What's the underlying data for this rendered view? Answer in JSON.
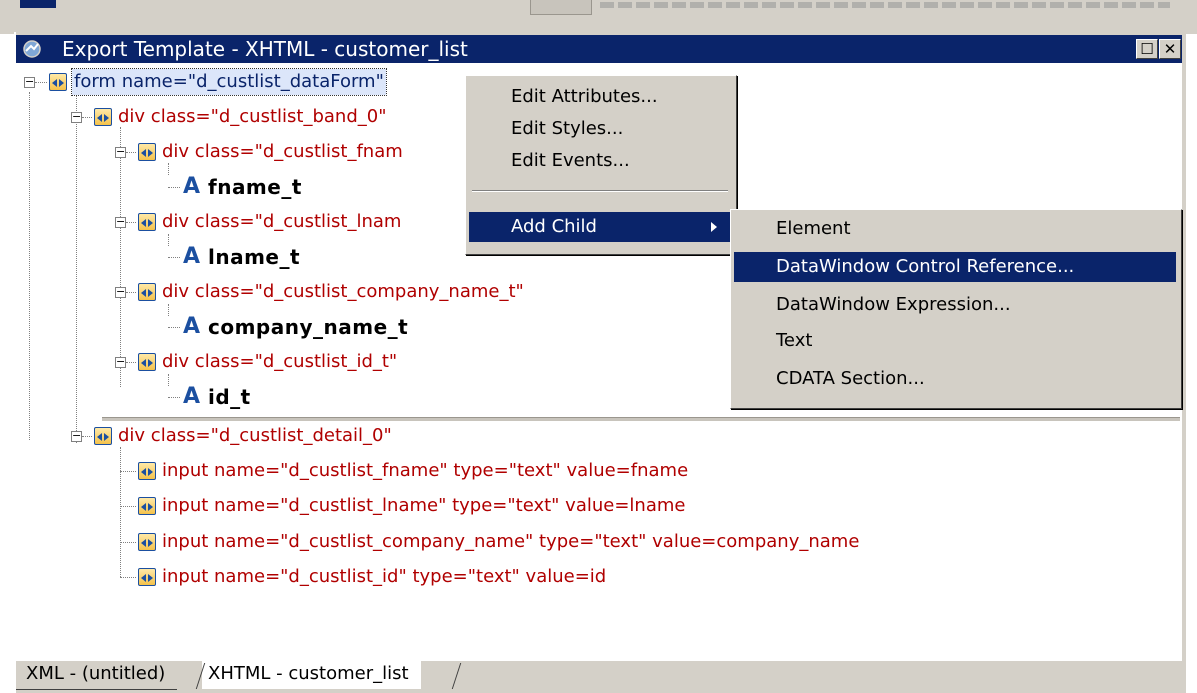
{
  "window": {
    "title": "Export Template - XHTML - customer_list",
    "maximize_glyph": "☐",
    "close_glyph": "✕"
  },
  "tree": {
    "nodes": [
      {
        "label": "form name=\"d_custlist_dataForm\"",
        "kind": "element",
        "expanded": true,
        "selected": true
      },
      {
        "label": "div class=\"d_custlist_band_0\"",
        "kind": "element",
        "expanded": true
      },
      {
        "label": "div class=\"d_custlist_fnam",
        "kind": "element",
        "expanded": true
      },
      {
        "label": "fname_t",
        "kind": "text"
      },
      {
        "label": "div class=\"d_custlist_lnam",
        "kind": "element",
        "expanded": true
      },
      {
        "label": "lname_t",
        "kind": "text"
      },
      {
        "label": "div class=\"d_custlist_company_name_t\"",
        "kind": "element",
        "expanded": true
      },
      {
        "label": "company_name_t",
        "kind": "text"
      },
      {
        "label": "div class=\"d_custlist_id_t\"",
        "kind": "element",
        "expanded": true
      },
      {
        "label": "id_t",
        "kind": "text"
      },
      {
        "label": "div class=\"d_custlist_detail_0\"",
        "kind": "element",
        "expanded": true
      },
      {
        "label": "input name=\"d_custlist_fname\" type=\"text\" value=fname",
        "kind": "element"
      },
      {
        "label": "input name=\"d_custlist_lname\" type=\"text\" value=lname",
        "kind": "element"
      },
      {
        "label": "input name=\"d_custlist_company_name\" type=\"text\" value=company_name",
        "kind": "element"
      },
      {
        "label": "input name=\"d_custlist_id\" type=\"text\" value=id",
        "kind": "element"
      }
    ],
    "expander_glyph": "−",
    "text_icon_glyph": "A"
  },
  "context_menu": {
    "items": [
      "Edit Attributes...",
      "Edit Styles...",
      "Edit Events...",
      "Add Child"
    ],
    "highlighted": "Add Child"
  },
  "submenu": {
    "items": [
      "Element",
      "DataWindow Control Reference...",
      "DataWindow Expression...",
      "Text",
      "CDATA Section..."
    ],
    "highlighted": "DataWindow Control Reference..."
  },
  "tabs": [
    "XML - (untitled)",
    "XHTML - customer_list"
  ],
  "active_tab": "XHTML - customer_list",
  "colors": {
    "titlebar": "#0a246a",
    "element_text": "#b00000",
    "menu_highlight": "#0a246a",
    "chrome": "#d4d0c8"
  }
}
